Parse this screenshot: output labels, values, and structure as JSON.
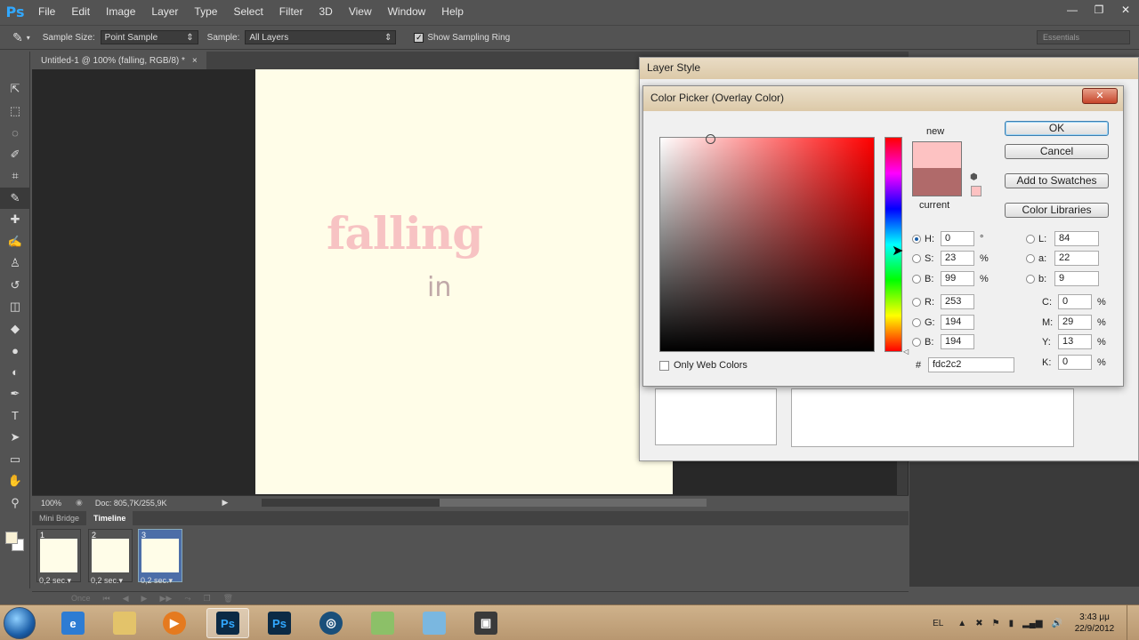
{
  "app": {
    "logo": "Ps",
    "window_buttons": [
      "—",
      "❐",
      "✕"
    ]
  },
  "menu": [
    "File",
    "Edit",
    "Image",
    "Layer",
    "Type",
    "Select",
    "Filter",
    "3D",
    "View",
    "Window",
    "Help"
  ],
  "options_bar": {
    "tool_icon": "eyedropper-icon",
    "sample_size_label": "Sample Size:",
    "sample_size_value": "Point Sample",
    "sample_label": "Sample:",
    "sample_value": "All Layers",
    "show_sampling_ring_label": "Show Sampling Ring",
    "show_sampling_ring_checked": true,
    "workspace": "Essentials"
  },
  "document": {
    "tab_title": "Untitled-1 @ 100% (falling, RGB/8) *",
    "tab_close": "×",
    "canvas_text_1": "falling",
    "canvas_text_2": "in",
    "canvas_color": "#fffde8"
  },
  "status": {
    "zoom": "100%",
    "doc_info": "Doc: 805,7K/255,9K"
  },
  "timeline": {
    "tabs": [
      "Mini Bridge",
      "Timeline"
    ],
    "active_tab": "Timeline",
    "frames": [
      {
        "num": "1",
        "time": "0,2 sec.▾",
        "selected": false
      },
      {
        "num": "2",
        "time": "0,2 sec.▾",
        "selected": false
      },
      {
        "num": "3",
        "time": "0,2 sec.▾",
        "selected": true
      }
    ],
    "loop": "Once"
  },
  "layer_style": {
    "title": "Layer Style"
  },
  "color_picker": {
    "title": "Color Picker (Overlay Color)",
    "close": "✕",
    "new_label": "new",
    "current_label": "current",
    "new_color": "#fdc2c2",
    "current_color": "#b06a6a",
    "buttons": {
      "ok": "OK",
      "cancel": "Cancel",
      "add_swatches": "Add to Swatches",
      "color_libraries": "Color Libraries"
    },
    "fields": {
      "H": {
        "label": "H:",
        "value": "0",
        "unit": "°"
      },
      "S": {
        "label": "S:",
        "value": "23",
        "unit": "%"
      },
      "B": {
        "label": "B:",
        "value": "99",
        "unit": "%"
      },
      "R": {
        "label": "R:",
        "value": "253"
      },
      "G": {
        "label": "G:",
        "value": "194"
      },
      "Bl": {
        "label": "B:",
        "value": "194"
      },
      "L": {
        "label": "L:",
        "value": "84"
      },
      "a": {
        "label": "a:",
        "value": "22"
      },
      "b": {
        "label": "b:",
        "value": "9"
      },
      "C": {
        "label": "C:",
        "value": "0",
        "unit": "%"
      },
      "M": {
        "label": "M:",
        "value": "29",
        "unit": "%"
      },
      "Y": {
        "label": "Y:",
        "value": "13",
        "unit": "%"
      },
      "K": {
        "label": "K:",
        "value": "0",
        "unit": "%"
      }
    },
    "hex_label": "#",
    "hex": "fdc2c2",
    "only_web_colors": "Only Web Colors"
  },
  "taskbar": {
    "language": "EL",
    "time": "3:43 μμ",
    "date": "22/9/2012"
  }
}
